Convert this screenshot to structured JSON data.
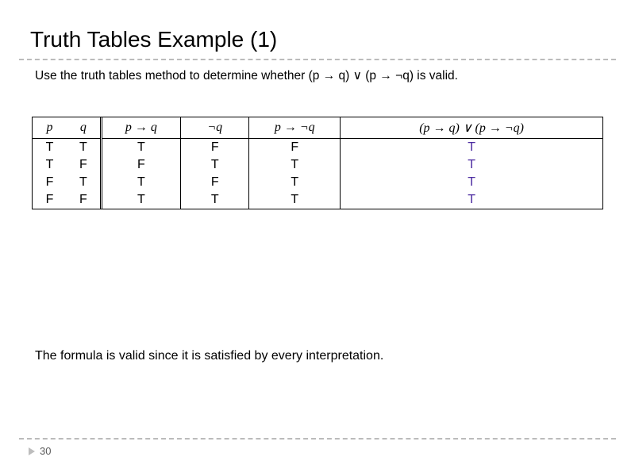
{
  "title": "Truth Tables Example (1)",
  "subtitle": "Use the truth tables method to determine whether (p → q) ∨ (p → ¬q) is valid.",
  "conclusion": "The formula is valid since it is satisfied by every interpretation.",
  "page_number": "30",
  "table": {
    "headers": [
      "p",
      "q",
      "p → q",
      "¬q",
      "p → ¬q",
      "(p → q) ∨ (p → ¬q)"
    ],
    "rows": [
      [
        "T",
        "T",
        "T",
        "F",
        "F",
        "T"
      ],
      [
        "T",
        "F",
        "F",
        "T",
        "T",
        "T"
      ],
      [
        "F",
        "T",
        "T",
        "F",
        "T",
        "T"
      ],
      [
        "F",
        "F",
        "T",
        "T",
        "T",
        "T"
      ]
    ]
  }
}
